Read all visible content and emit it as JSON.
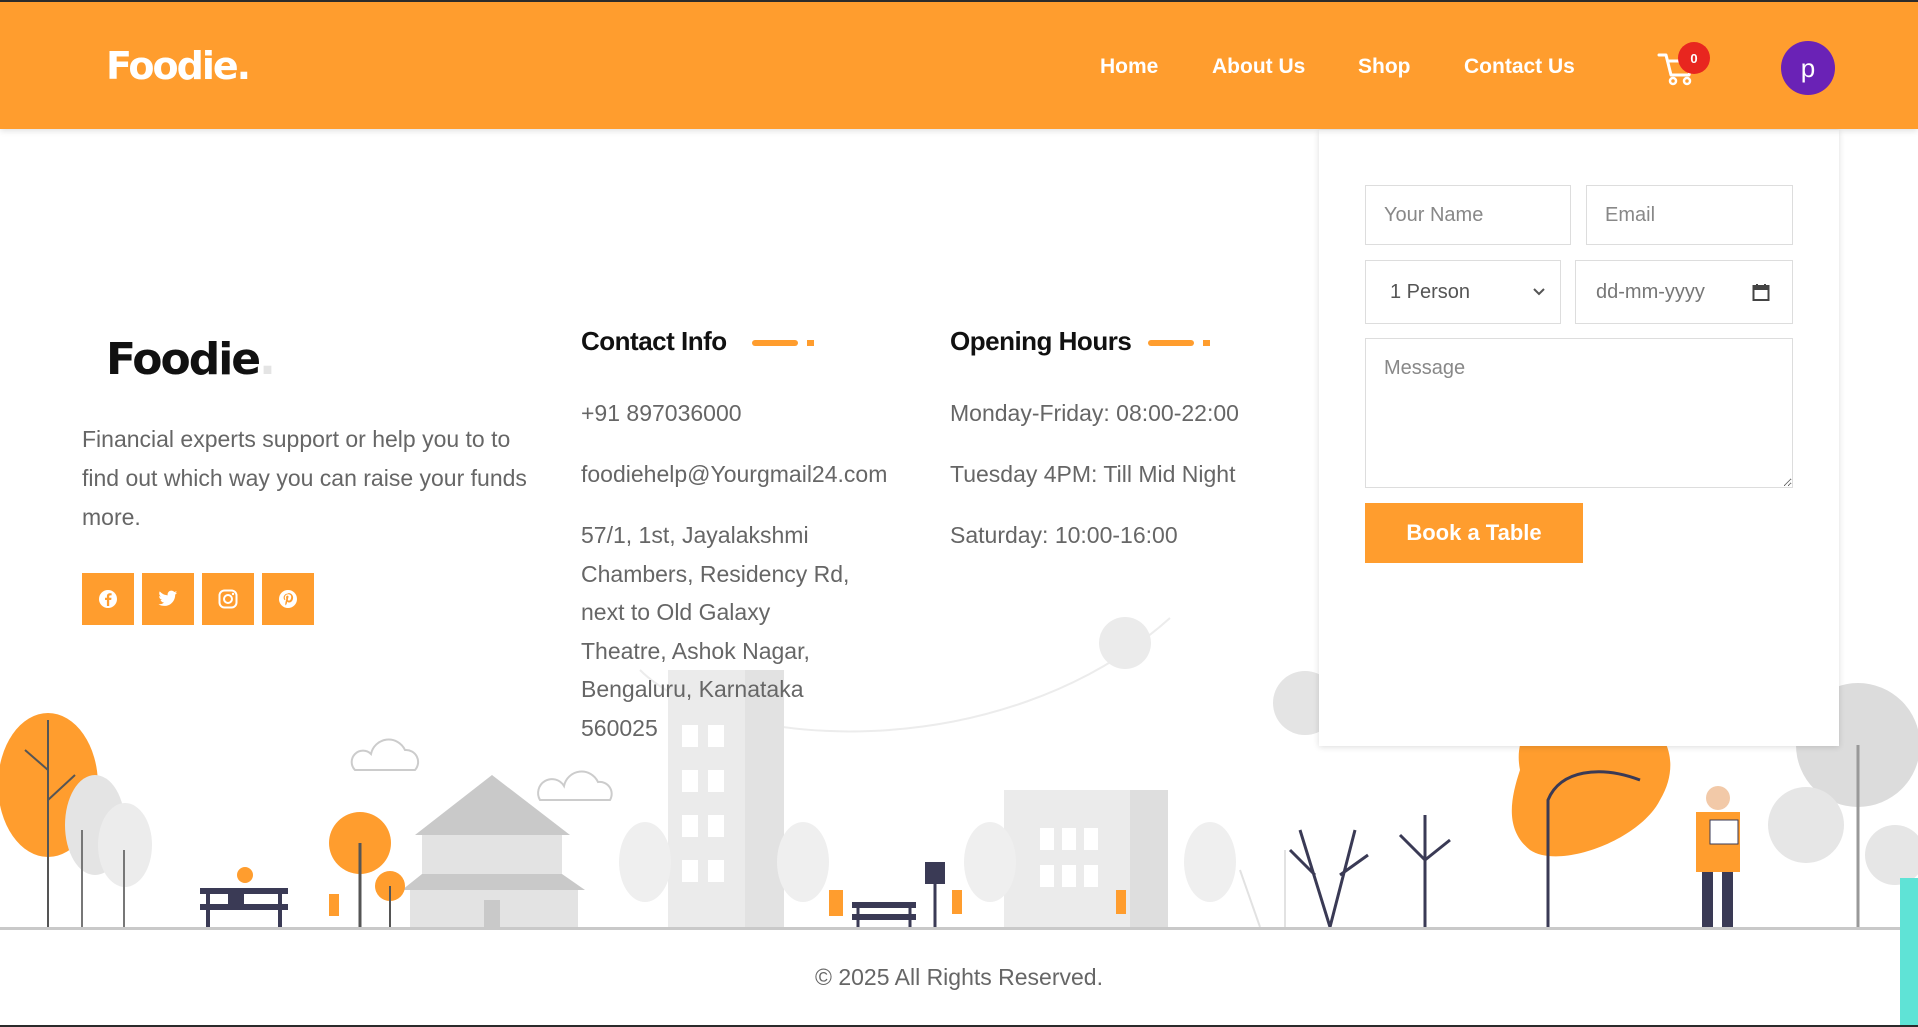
{
  "header": {
    "brand": "Foodie.",
    "nav": [
      "Home",
      "About Us",
      "Shop",
      "Contact Us"
    ],
    "cart_count": "0",
    "avatar_initial": "p"
  },
  "about": {
    "brand": "Foodie",
    "text": "Financial experts support or help you to to find out which way you can raise your funds more.",
    "socials": [
      "facebook-icon",
      "twitter-icon",
      "instagram-icon",
      "pinterest-icon"
    ]
  },
  "contact": {
    "title": "Contact Info",
    "phone": "+91 897036000",
    "email": "foodiehelp@Yourgmail24.com",
    "address": [
      "57/1, 1st, Jayalakshmi",
      "Chambers, Residency Rd,",
      "next to Old Galaxy",
      "Theatre, Ashok Nagar,",
      "Bengaluru, Karnataka",
      "560025"
    ]
  },
  "hours": {
    "title": "Opening Hours",
    "lines": [
      "Monday-Friday: 08:00-22:00",
      "Tuesday 4PM: Till Mid Night",
      "Saturday: 10:00-16:00"
    ]
  },
  "booking": {
    "title": "Book a Table",
    "name_placeholder": "Your Name",
    "email_placeholder": "Email",
    "persons_value": "1 Person",
    "date_placeholder": "dd-mm-yyyy",
    "message_placeholder": "Message",
    "button": "Book a Table"
  },
  "footer": {
    "copyright": "© 2025 All Rights Reserved."
  },
  "colors": {
    "accent": "#ff9d2e",
    "badge": "#e8261f",
    "avatar": "#6a22b6",
    "strip": "#5fe3d6"
  }
}
